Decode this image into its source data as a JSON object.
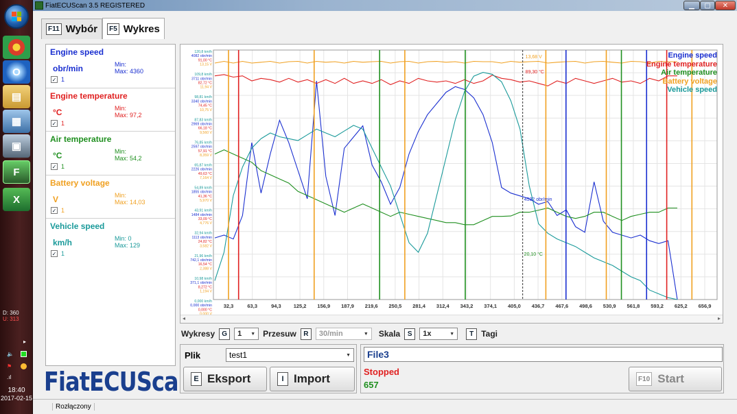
{
  "taskbar": {
    "tray_d": "D: 360",
    "tray_u": "U: 313",
    "clock_time": "18:40",
    "clock_date": "2017-02-15"
  },
  "window": {
    "title": "FiatECUScan 3.5 REGISTERED"
  },
  "tabs": [
    {
      "key": "F11",
      "label": "Wybór"
    },
    {
      "key": "F5",
      "label": "Wykres"
    }
  ],
  "series": [
    {
      "title": "Engine speed",
      "unit": "obr/min",
      "min": "Min:",
      "max": "Max: 4360",
      "checked_value": "1",
      "color": "#1a2fd0"
    },
    {
      "title": "Engine temperature",
      "unit": "°C",
      "min": "Min:",
      "max": "Max: 97,2",
      "checked_value": "1",
      "color": "#e02020"
    },
    {
      "title": "Air temperature",
      "unit": "°C",
      "min": "Min:",
      "max": "Max: 54,2",
      "checked_value": "1",
      "color": "#1f8f1f"
    },
    {
      "title": "Battery voltage",
      "unit": "V",
      "min": "Min:",
      "max": "Max: 14,03",
      "checked_value": "1",
      "color": "#f0a020"
    },
    {
      "title": "Vehicle speed",
      "unit": "km/h",
      "min": "Min: 0",
      "max": "Max: 129",
      "checked_value": "1",
      "color": "#1a9a9a"
    }
  ],
  "logo": "FiatECUScan",
  "controls": {
    "wykresy_label": "Wykresy",
    "wykresy_key": "G",
    "wykresy_value": "1",
    "przesuw_label": "Przesuw",
    "przesuw_key": "R",
    "przesuw_value": "30/min",
    "skala_label": "Skala",
    "skala_key": "S",
    "skala_value": "1x",
    "tagi_key": "T",
    "tagi_label": "Tagi"
  },
  "file": {
    "plik_label": "Plik",
    "plik_value": "test1",
    "eksport_key": "E",
    "eksport_label": "Eksport",
    "import_key": "I",
    "import_label": "Import"
  },
  "status": {
    "file_name": "File3",
    "state": "Stopped",
    "count": "657",
    "start_key": "F10",
    "start_label": "Start"
  },
  "statusbar": {
    "connection": "Rozłączony"
  },
  "chart_data": {
    "type": "line",
    "x_ticks": [
      "32,3",
      "63,3",
      "94,3",
      "125,2",
      "156,9",
      "187,9",
      "219,6",
      "250,5",
      "281,4",
      "312,4",
      "343,2",
      "374,1",
      "405,0",
      "436,7",
      "467,6",
      "498,6",
      "530,9",
      "561,8",
      "593,2",
      "625,2",
      "656,9"
    ],
    "y_axis_labels": {
      "engine_speed": [
        "4082 obr/min",
        "3711 obr/min",
        "3340 obr/min",
        "2969 obr/min",
        "2597 obr/min",
        "2226 obr/min",
        "1855 obr/min",
        "1484 obr/min",
        "1113 obr/min",
        "742,1 obr/min",
        "371,1 obr/min",
        "0,000 obr/min"
      ],
      "vehicle_speed": [
        "120,8 km/h",
        "109,8 km/h",
        "98,81 km/h",
        "87,83 km/h",
        "76,85 km/h",
        "65,87 km/h",
        "54,89 km/h",
        "43,91 km/h",
        "32,94 km/h",
        "21,96 km/h",
        "10,98 km/h",
        "0,000 km/h"
      ],
      "engine_temperature": [
        "91,00 °C",
        "82,72 °C",
        "74,45 °C",
        "66,18 °C",
        "57,91 °C",
        "49,63 °C",
        "41,36 °C",
        "33,09 °C",
        "24,82 °C",
        "16,54 °C",
        "8,272 °C",
        "0,000 °C"
      ],
      "battery_voltage": [
        "13,15 V",
        "11,94 V",
        "10,75 V",
        "9,560 V",
        "8,359 V",
        "7,164 V",
        "5,970 V",
        "4,776 V",
        "3,582 V",
        "2,388 V",
        "1,194 V",
        "0,000 V"
      ]
    },
    "annotations": [
      "13,68 V",
      "89,30 °C",
      "4532 obr/min",
      "20,10 °C"
    ],
    "series": [
      {
        "name": "Engine speed",
        "color": "#1a2fd0",
        "values": [
          1100,
          1150,
          1080,
          1500,
          2800,
          1900,
          2600,
          3200,
          2800,
          2300,
          1800,
          3900,
          2200,
          1500,
          2700,
          2900,
          3100,
          2400,
          2100,
          1700,
          2000,
          2600,
          3000,
          3300,
          3500,
          3700,
          3800,
          3750,
          3600,
          3300,
          2800,
          2000,
          1900,
          1850,
          1800,
          1700,
          1750,
          1500,
          1600,
          1300,
          1200,
          2100,
          1400,
          1200,
          1150,
          1100,
          1150,
          1050,
          1000,
          1050,
          0
        ]
      },
      {
        "name": "Engine temperature",
        "color": "#e02020",
        "values": [
          89,
          89.5,
          88.5,
          89,
          87,
          88,
          87.5,
          86.5,
          88,
          86.5,
          87.5,
          86,
          87.5,
          86,
          88,
          86,
          87,
          86,
          87.5,
          85.5,
          87,
          86,
          88,
          87,
          86.5,
          87,
          86,
          87.5,
          86,
          87,
          89.3,
          88,
          87.5,
          86.5,
          87,
          86,
          85,
          87,
          86,
          88,
          87,
          86,
          87,
          88,
          86.5,
          87,
          86,
          88,
          87,
          89,
          89
        ]
      },
      {
        "name": "Air temperature",
        "color": "#1f8f1f",
        "values": [
          35,
          36,
          35,
          34,
          33,
          31,
          30,
          29,
          28,
          26,
          25,
          24,
          23,
          22,
          21,
          22,
          23,
          22,
          21,
          20,
          21,
          20.5,
          20,
          19.5,
          19,
          18.5,
          18.5,
          18,
          18,
          19,
          20,
          20,
          20.1,
          21,
          21,
          21.5,
          22,
          21,
          20,
          19.5,
          20,
          21,
          21,
          20,
          19,
          20,
          20.5,
          21,
          21,
          22,
          22
        ]
      },
      {
        "name": "Battery voltage",
        "color": "#f0a020",
        "values": [
          13.6,
          13.7,
          13.6,
          13.7,
          13.6,
          13.65,
          13.7,
          13.6,
          13.68,
          13.7,
          13.6,
          13.7,
          13.65,
          13.68,
          13.6,
          13.7,
          13.65,
          13.68,
          13.7,
          13.6,
          13.68,
          13.7,
          13.6,
          13.68,
          13.7,
          13.65,
          13.68,
          13.6,
          13.7,
          13.68,
          13.68,
          13.6,
          13.7,
          13.65,
          13.68,
          13.7,
          13.6,
          13.65,
          13.68,
          13.7,
          13.6,
          13.68,
          13.7,
          13.65,
          13.6,
          13.7,
          13.68,
          13.6,
          13.7,
          13.68,
          13.68
        ]
      },
      {
        "name": "Vehicle speed",
        "color": "#1a9a9a",
        "values": [
          10,
          25,
          55,
          70,
          80,
          85,
          88,
          86,
          85,
          84,
          87,
          90,
          88,
          86,
          89,
          92,
          90,
          80,
          70,
          60,
          45,
          30,
          25,
          35,
          55,
          75,
          95,
          110,
          118,
          120,
          119,
          115,
          105,
          90,
          60,
          40,
          35,
          32,
          30,
          28,
          25,
          22,
          20,
          18,
          15,
          12,
          10,
          5,
          3,
          1,
          0
        ]
      }
    ]
  }
}
